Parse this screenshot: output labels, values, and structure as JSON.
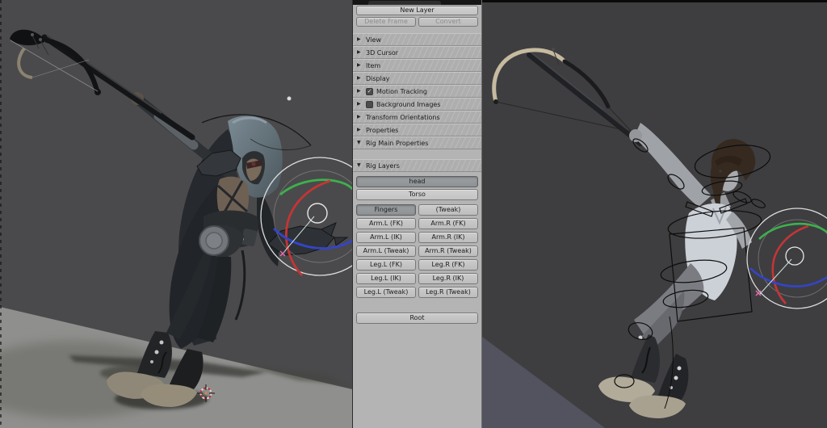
{
  "icons": {
    "collapsed": "▶",
    "expanded": "▼",
    "check": "✓"
  },
  "colors": {
    "axis_x": "#c43535",
    "axis_y": "#3db14d",
    "axis_z": "#3444c9",
    "gizmo_ring": "#dcdcdc",
    "gizmo_inner_ring": "#8e8e8e",
    "crosshair_pink": "#e66fae"
  },
  "panel": {
    "new_layer_label": "New Layer",
    "delete_frame_label": "Delete Frame",
    "convert_label": "Convert",
    "sections": [
      {
        "label": "View",
        "state": "collapsed"
      },
      {
        "label": "3D Cursor",
        "state": "collapsed"
      },
      {
        "label": "Item",
        "state": "collapsed"
      },
      {
        "label": "Display",
        "state": "collapsed"
      },
      {
        "label": "Motion Tracking",
        "state": "collapsed",
        "checkbox": "checked"
      },
      {
        "label": "Background Images",
        "state": "collapsed",
        "checkbox": "unchecked"
      },
      {
        "label": "Transform Orientations",
        "state": "collapsed"
      },
      {
        "label": "Properties",
        "state": "collapsed"
      },
      {
        "label": "Rig Main Properties",
        "state": "expanded"
      },
      {
        "label": "Rig Layers",
        "state": "expanded"
      }
    ],
    "rig_layers": {
      "head": "head",
      "torso": "Torso",
      "grid": [
        [
          "Fingers",
          "(Tweak)"
        ],
        [
          "Arm.L (FK)",
          "Arm.R (FK)"
        ],
        [
          "Arm.L (IK)",
          "Arm.R (IK)"
        ],
        [
          "Arm.L (Tweak)",
          "Arm.R (Tweak)"
        ],
        [
          "Leg.L (FK)",
          "Leg.R (FK)"
        ],
        [
          "Leg.L (IK)",
          "Leg.R (IK)"
        ],
        [
          "Leg.L (Tweak)",
          "Leg.R (Tweak)"
        ]
      ],
      "root": "Root",
      "pressed_buttons": [
        "head",
        "Fingers"
      ]
    }
  },
  "left_viewport": {
    "scene": "Textured hooded archer aiming crossbow up-left, crouched on gray ground plane with cast shadow and 3D cursor"
  },
  "right_viewport": {
    "scene": "Untextured gray mannequin in same archer pose with black rig control wires and rotation gizmo"
  }
}
